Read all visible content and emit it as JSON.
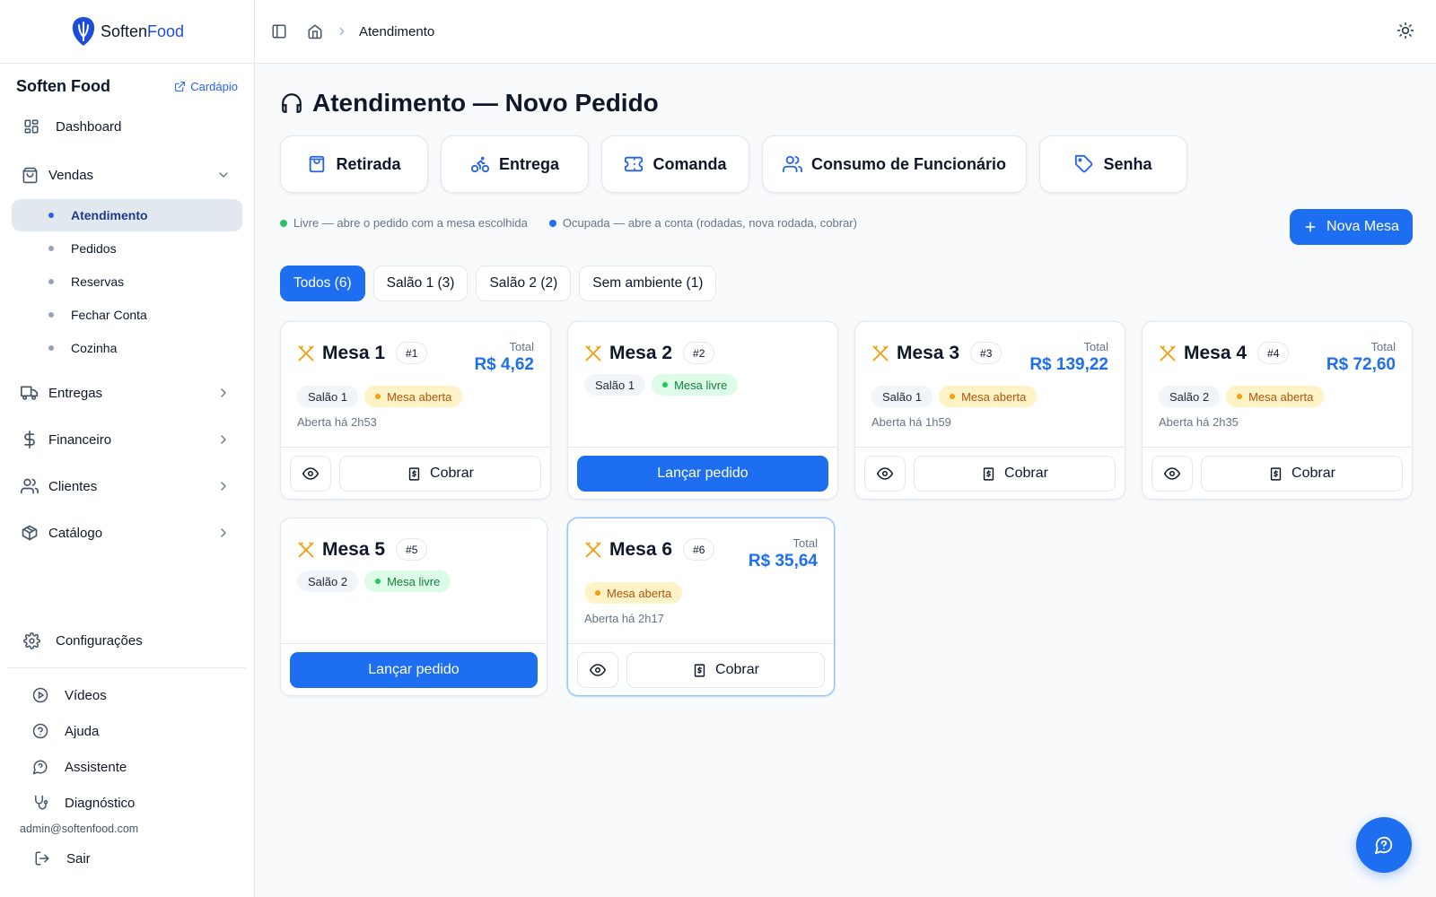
{
  "app": {
    "logo_soften": "Soften",
    "logo_food": "Food"
  },
  "sidebar": {
    "brand": "Soften Food",
    "menu_link": "Cardápio",
    "dashboard": "Dashboard",
    "vendas": "Vendas",
    "sub_items": [
      "Atendimento",
      "Pedidos",
      "Reservas",
      "Fechar Conta",
      "Cozinha"
    ],
    "entregas": "Entregas",
    "financeiro": "Financeiro",
    "clientes": "Clientes",
    "catalogo": "Catálogo",
    "configuracoes": "Configurações",
    "videos": "Vídeos",
    "ajuda": "Ajuda",
    "assistente": "Assistente",
    "diagnostico": "Diagnóstico",
    "email": "admin@softenfood.com",
    "sair": "Sair"
  },
  "breadcrumb": {
    "current": "Atendimento"
  },
  "page": {
    "title": "Atendimento — Novo Pedido"
  },
  "modes": [
    "Retirada",
    "Entrega",
    "Comanda",
    "Consumo de Funcionário",
    "Senha"
  ],
  "legend": {
    "free": "Livre — abre o pedido com a mesa escolhida",
    "busy": "Ocupada — abre a conta (rodadas, nova rodada, cobrar)"
  },
  "new_table_label": "Nova Mesa",
  "filters": [
    "Todos (6)",
    "Salão 1 (3)",
    "Salão 2 (2)",
    "Sem ambiente (1)"
  ],
  "common": {
    "total_label": "Total",
    "open_status": "Mesa aberta",
    "free_status": "Mesa livre",
    "charge": "Cobrar",
    "launch": "Lançar pedido"
  },
  "tables": [
    {
      "name": "Mesa 1",
      "number": "#1",
      "area": "Salão 1",
      "status": "open",
      "total": "R$ 4,62",
      "since": "Aberta há 2h53"
    },
    {
      "name": "Mesa 2",
      "number": "#2",
      "area": "Salão 1",
      "status": "free"
    },
    {
      "name": "Mesa 3",
      "number": "#3",
      "area": "Salão 1",
      "status": "open",
      "total": "R$ 139,22",
      "since": "Aberta há 1h59"
    },
    {
      "name": "Mesa 4",
      "number": "#4",
      "area": "Salão 2",
      "status": "open",
      "total": "R$ 72,60",
      "since": "Aberta há 2h35"
    },
    {
      "name": "Mesa 5",
      "number": "#5",
      "area": "Salão 2",
      "status": "free"
    },
    {
      "name": "Mesa 6",
      "number": "#6",
      "area": "",
      "status": "open",
      "total": "R$ 35,64",
      "since": "Aberta há 2h17"
    }
  ],
  "colors": {
    "primary": "#1d6ef0",
    "open": "#f59e0b",
    "free": "#22c55e",
    "busy": "#1d6ef0"
  }
}
